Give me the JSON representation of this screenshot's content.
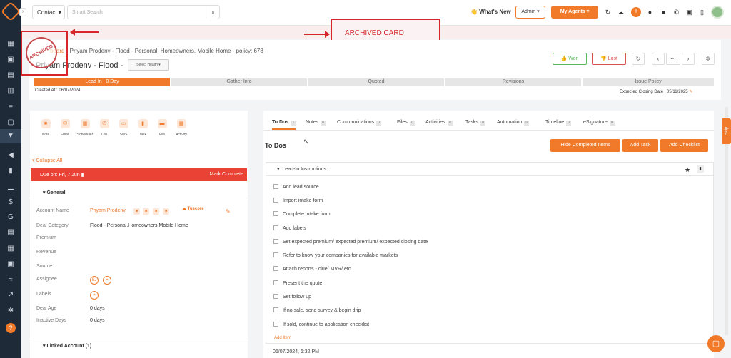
{
  "topbar": {
    "contact_select": "Contact",
    "search_placeholder": "Smart Search",
    "whats_new": "What's New",
    "admin": "Admin",
    "my_agents": "My Agents"
  },
  "annotation": {
    "archived_card": "ARCHIVED CARD",
    "stamp_text": "ARCHIVED"
  },
  "header": {
    "breadcrumb_prefix": "board",
    "breadcrumb_rest": "Priyam Prodenv - Flood - Personal, Homeowners, Mobile Home - policy: 678",
    "title": "Priyam Prodenv - Flood -",
    "select_health": "Select Health",
    "won": "Won",
    "lost": "Lost",
    "created_at": "Created At : 06/07/2024",
    "expected_closing": "Expected Closing Date : 05/11/2025"
  },
  "stages": [
    "Lead In | 0 Day",
    "Gather Info",
    "Quoted",
    "Revisions",
    "Issue Policy"
  ],
  "actions": [
    "Note",
    "Email",
    "Scheduler",
    "Call",
    "SMS",
    "Task",
    "File",
    "Activity"
  ],
  "left": {
    "collapse_all": "Collapse All",
    "due_on": "Due on: Fri, 7 Jun",
    "mark_complete": "Mark Complete",
    "general": "General",
    "fields": {
      "account_name_label": "Account Name",
      "account_name_value": "Priyam Prodenv",
      "deal_category_label": "Deal Category",
      "deal_category_value": "Flood - Personal,Homeowners,Mobile Home",
      "premium_label": "Premium",
      "revenue_label": "Revenue",
      "source_label": "Source",
      "assignee_label": "Assignee",
      "assignee_initials": "SJ",
      "labels_label": "Labels",
      "deal_age_label": "Deal Age",
      "deal_age_value": "0 days",
      "inactive_days_label": "Inactive Days",
      "inactive_days_value": "0 days"
    },
    "tuscore": "Tuscore",
    "linked_account": "Linked Account (1)"
  },
  "tabs": [
    {
      "label": "To Dos",
      "count": "1"
    },
    {
      "label": "Notes",
      "count": "0"
    },
    {
      "label": "Communications",
      "count": "0"
    },
    {
      "label": "Files",
      "count": "0"
    },
    {
      "label": "Activities",
      "count": "0"
    },
    {
      "label": "Tasks",
      "count": "0"
    },
    {
      "label": "Automation",
      "count": "0"
    },
    {
      "label": "Timeline",
      "count": "0"
    },
    {
      "label": "eSignature",
      "count": "0"
    }
  ],
  "todos": {
    "title": "To Dos",
    "hide_completed": "Hide Completed Items",
    "add_task": "Add Task",
    "add_checklist": "Add Checklist",
    "checklist_title": "Lead-In Instructions",
    "items": [
      "Add lead source",
      "Import intake form",
      "Complete intake form",
      "Add labels",
      "Set expected premium/ expected premium/ expected closing date",
      "Refer to know your companies for available markets",
      "Attach reports - clue/ MVR/ etc.",
      "Present the quote",
      "Set follow up",
      "If no sale, send survey & begin drip",
      "If sold, continue to application checklist"
    ],
    "add_item": "Add Item",
    "footer_date": "06/07/2024, 6:32 PM"
  },
  "help": "Help"
}
